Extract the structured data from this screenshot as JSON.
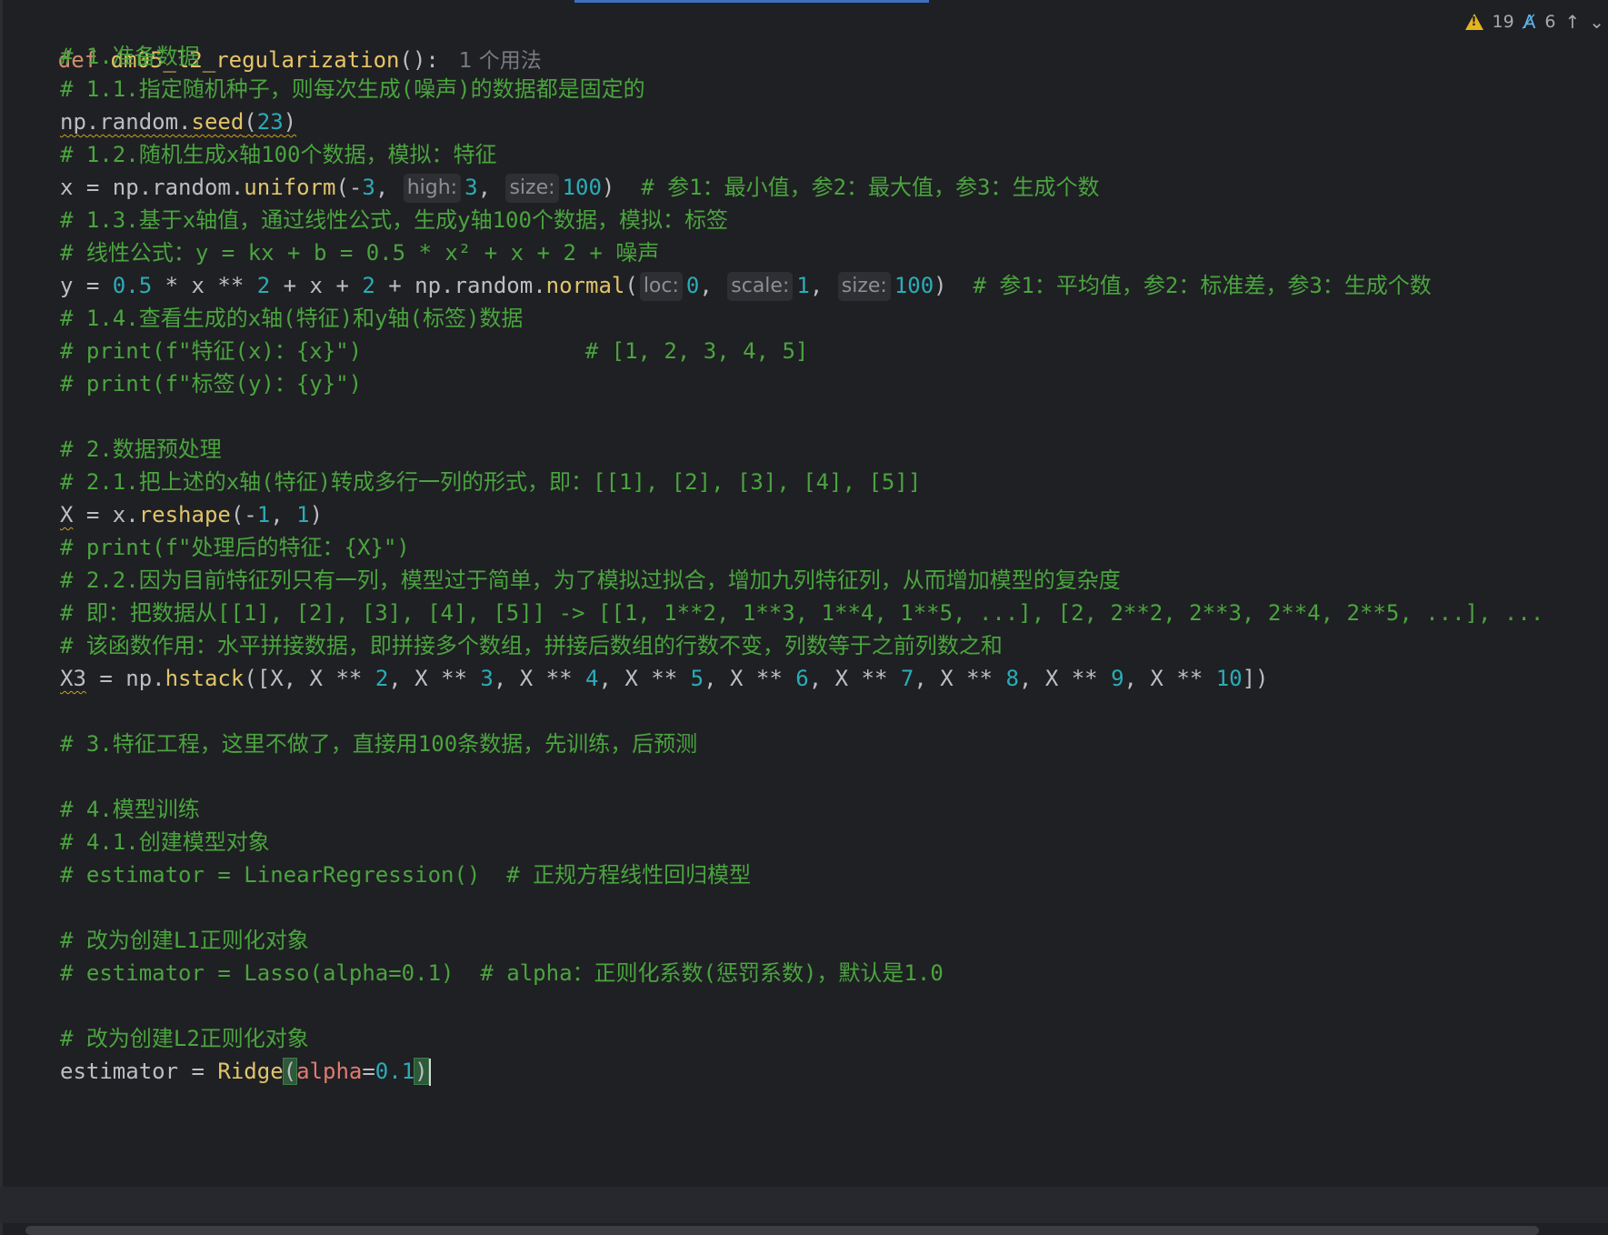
{
  "editor": {
    "status": {
      "warnings": "19",
      "typos": "6"
    },
    "usages": "1 个用法",
    "lines": {
      "l1_def": "def",
      "l1_name": "dm05_l2_regularization",
      "l1_rest": "():",
      "c1": "# 1.准备数据",
      "c2": "# 1.1.指定随机种子，则每次生成(噪声)的数据都是固定的",
      "seed_a": "np.random.",
      "seed_fn": "seed",
      "seed_p1": "(",
      "seed_num": "23",
      "seed_p2": ")",
      "c3": "# 1.2.随机生成x轴100个数据，模拟：特征",
      "x_a": "x = np.random.",
      "x_fn": "uniform",
      "x_p": "(-",
      "x_n1": "3",
      "x_comma1": ", ",
      "x_hint_high": "high:",
      "x_n2": "3",
      "x_comma2": ", ",
      "x_hint_size": "size:",
      "x_n3": "100",
      "x_close": ")",
      "x_cm": "  # 参1：最小值，参2：最大值，参3：生成个数",
      "c4": "# 1.3.基于x轴值，通过线性公式，生成y轴100个数据，模拟：标签",
      "c5": "# 线性公式：y = kx + b = 0.5 * x² + x + 2 + 噪声",
      "y_a": "y = ",
      "y_n1": "0.5",
      "y_b": " * x ** ",
      "y_n2": "2",
      "y_c": " + x + ",
      "y_n3": "2",
      "y_d": " + np.random.",
      "y_fn": "normal",
      "y_p": "(",
      "y_hint_loc": "loc:",
      "y_n4": "0",
      "y_comma1": ", ",
      "y_hint_scale": "scale:",
      "y_n5": "1",
      "y_comma2": ", ",
      "y_hint_size": "size:",
      "y_n6": "100",
      "y_close": ")",
      "y_cm": "  # 参1：平均值，参2：标准差，参3：生成个数",
      "c6": "# 1.4.查看生成的x轴(特征)和y轴(标签)数据",
      "c7": "# print(f\"特征(x)：{x}\")                 # [1, 2, 3, 4, 5]",
      "c8": "# print(f\"标签(y)：{y}\")",
      "c9": "# 2.数据预处理",
      "c10": "# 2.1.把上述的x轴(特征)转成多行一列的形式，即：[[1], [2], [3], [4], [5]]",
      "X_var": "X",
      "X_a": " = x.",
      "X_fn": "reshape",
      "X_p": "(-",
      "X_n1": "1",
      "X_comma": ", ",
      "X_n2": "1",
      "X_close": ")",
      "c11": "# print(f\"处理后的特征：{X}\")",
      "c12": "# 2.2.因为目前特征列只有一列，模型过于简单，为了模拟过拟合，增加九列特征列，从而增加模型的复杂度",
      "c13": "# 即：把数据从[[1], [2], [3], [4], [5]] -> [[1, 1**2, 1**3, 1**4, 1**5, ...], [2, 2**2, 2**3, 2**4, 2**5, ...], ...",
      "c14": "# 该函数作用：水平拼接数据，即拼接多个数组，拼接后数组的行数不变，列数等于之前列数之和",
      "X3_var": "X3",
      "X3_a": " = np.",
      "X3_fn": "hstack",
      "X3_b": "([X, X ** ",
      "X3_n2": "2",
      "X3_c": ", X ** ",
      "X3_n3": "3",
      "X3_d": ", X ** ",
      "X3_n4": "4",
      "X3_e": ", X ** ",
      "X3_n5": "5",
      "X3_f": ", X ** ",
      "X3_n6": "6",
      "X3_g": ", X ** ",
      "X3_n7": "7",
      "X3_h": ", X ** ",
      "X3_n8": "8",
      "X3_i": ", X ** ",
      "X3_n9": "9",
      "X3_j": ", X ** ",
      "X3_n10": "10",
      "X3_close": "])",
      "c15": "# 3.特征工程，这里不做了，直接用100条数据，先训练，后预测",
      "c16": "# 4.模型训练",
      "c17": "# 4.1.创建模型对象",
      "c18": "# estimator = LinearRegression()  # 正规方程线性回归模型",
      "c19": "# 改为创建L1正则化对象",
      "c20": "# estimator = Lasso(alpha=0.1)  # alpha：正则化系数(惩罚系数)，默认是1.0",
      "c21": "# 改为创建L2正则化对象",
      "est_a": "estimator = ",
      "est_fn": "Ridge",
      "est_open": "(",
      "est_param": "alpha",
      "est_eq": "=",
      "est_num": "0.1",
      "est_close": ")"
    }
  }
}
